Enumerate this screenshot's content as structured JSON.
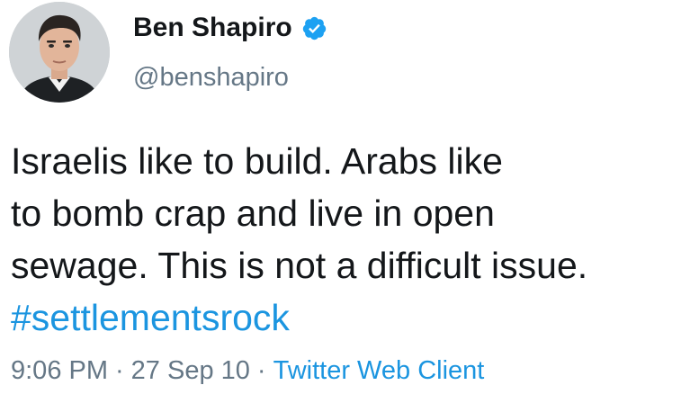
{
  "author": {
    "display_name": "Ben Shapiro",
    "handle": "@benshapiro",
    "verified": true,
    "verified_icon": "verified-badge-icon"
  },
  "tweet": {
    "lines": [
      "Israelis like to build. Arabs like",
      "to bomb crap and live in open",
      "sewage. This is not a difficult issue."
    ],
    "hashtag": "#settlementsrock"
  },
  "meta": {
    "time": "9:06 PM",
    "separator": "·",
    "date": "27 Sep 10",
    "client": "Twitter Web Client"
  },
  "colors": {
    "link": "#1b95e0",
    "secondary_text": "#657786",
    "primary_text": "#14171a",
    "verified_badge": "#1da1f2"
  }
}
